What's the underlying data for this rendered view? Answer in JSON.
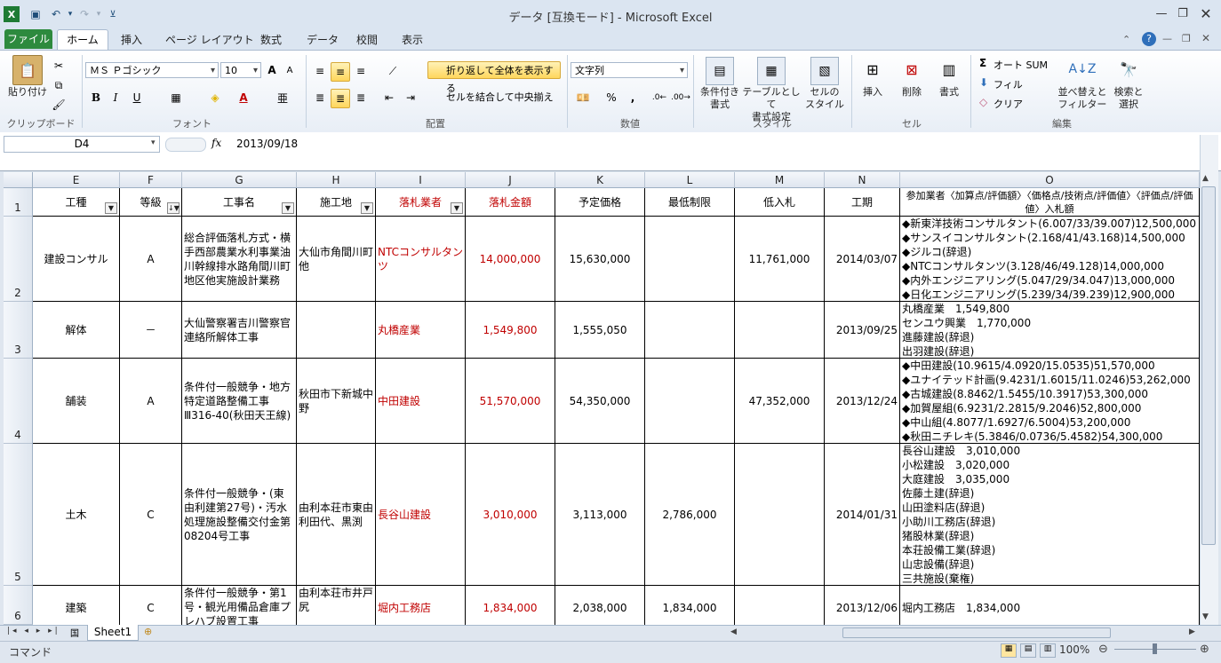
{
  "window": {
    "title": "データ [互換モード] - Microsoft Excel"
  },
  "tabs": [
    "ファイル",
    "ホーム",
    "挿入",
    "ページ レイアウト",
    "数式",
    "データ",
    "校閲",
    "表示"
  ],
  "ribbon": {
    "clipboard": {
      "paste": "貼り付け",
      "label": "クリップボード"
    },
    "font": {
      "name": "ＭＳ Ｐゴシック",
      "size": "10",
      "bold": "B",
      "italic": "I",
      "underline": "U",
      "label": "フォント",
      "grow": "A",
      "shrink": "A"
    },
    "alignment": {
      "wrap": "折り返して全体を表示する",
      "merge": "セルを結合して中央揃え",
      "label": "配置"
    },
    "number": {
      "format": "文字列",
      "percent": "%",
      "comma": ",",
      "label": "数値"
    },
    "styles": {
      "conditional": "条件付き\n書式",
      "table": "テーブルとして\n書式設定",
      "cell": "セルの\nスタイル",
      "label": "スタイル"
    },
    "cells": {
      "insert": "挿入",
      "delete": "削除",
      "format": "書式",
      "label": "セル"
    },
    "editing": {
      "autosum": "オート SUM",
      "fill": "フィル",
      "clear": "クリア",
      "sort": "並べ替えと\nフィルター",
      "find": "検索と\n選択",
      "label": "編集"
    }
  },
  "formula_bar": {
    "name_box": "D4",
    "fx": "fx",
    "value": "2013/09/18"
  },
  "columns": [
    "E",
    "F",
    "G",
    "H",
    "I",
    "J",
    "K",
    "L",
    "M",
    "N",
    "O"
  ],
  "header_row": {
    "row": "1",
    "cells": [
      "工種",
      "等級",
      "工事名",
      "施工地",
      "落札業者",
      "落札金額",
      "予定価格",
      "最低制限",
      "低入札",
      "工期",
      "参加業者〈加算点/評価額〉〈価格点/技術点/評価値〉〈評価点/評価値〉入札額"
    ]
  },
  "rows": [
    {
      "row": "2",
      "cells": [
        "建設コンサル",
        "A",
        "総合評価落札方式・横手西部農業水利事業油川幹線排水路角間川町地区他実施設計業務",
        "大仙市角間川町他",
        "NTCコンサルタンツ",
        "14,000,000",
        "15,630,000",
        "",
        "11,761,000",
        "2014/03/07",
        "◆新東洋技術コンサルタント(6.007/33/39.007)12,500,000\n◆サンスイコンサルタント(2.168/41/43.168)14,500,000\n◆ジルコ(辞退)\n◆NTCコンサルタンツ(3.128/46/49.128)14,000,000\n◆内外エンジニアリング(5.047/29/34.047)13,000,000\n◆日化エンジニアリング(5.239/34/39.239)12,900,000"
      ]
    },
    {
      "row": "3",
      "cells": [
        "解体",
        "－",
        "大仙警察署吉川警察官連絡所解体工事",
        "",
        "丸橋産業",
        "1,549,800",
        "1,555,050",
        "",
        "",
        "2013/09/25",
        "丸橋産業　1,549,800\nセンユウ興業　1,770,000\n進藤建設(辞退)\n出羽建設(辞退)"
      ]
    },
    {
      "row": "4",
      "cells": [
        "舗装",
        "A",
        "条件付一般競争・地方特定道路整備工事Ⅲ316-40(秋田天王線)",
        "秋田市下新城中野",
        "中田建設",
        "51,570,000",
        "54,350,000",
        "",
        "47,352,000",
        "2013/12/24",
        "◆中田建設(10.9615/4.0920/15.0535)51,570,000\n◆ユナイテッド計画(9.4231/1.6015/11.0246)53,262,000\n◆古城建設(8.8462/1.5455/10.3917)53,300,000\n◆加賀屋組(6.9231/2.2815/9.2046)52,800,000\n◆中山組(4.8077/1.6927/6.5004)53,200,000\n◆秋田ニチレキ(5.3846/0.0736/5.4582)54,300,000"
      ]
    },
    {
      "row": "5",
      "cells": [
        "土木",
        "C",
        "条件付一般競争・(東由利建第27号)・汚水処理施設整備交付金第08204号工事",
        "由利本荘市東由利田代、黒渕",
        "長谷山建設",
        "3,010,000",
        "3,113,000",
        "2,786,000",
        "",
        "2014/01/31",
        "長谷山建設　3,010,000\n小松建設　3,020,000\n大庭建設　3,035,000\n佐藤土建(辞退)\n山田塗料店(辞退)\n小助川工務店(辞退)\n猪股林業(辞退)\n本荘設備工業(辞退)\n山忠設備(辞退)\n三共施設(棄権)"
      ]
    },
    {
      "row": "6",
      "cells": [
        "建築",
        "C",
        "条件付一般競争・第1号・観光用備品倉庫プレハブ設置工事",
        "由利本荘市井戸尻",
        "堀内工務店",
        "1,834,000",
        "2,038,000",
        "1,834,000",
        "",
        "2013/12/06",
        "堀内工務店　1,834,000"
      ]
    }
  ],
  "sheet": {
    "tab": "Sheet1"
  },
  "status": {
    "mode": "コマンド",
    "zoom": "100%"
  }
}
